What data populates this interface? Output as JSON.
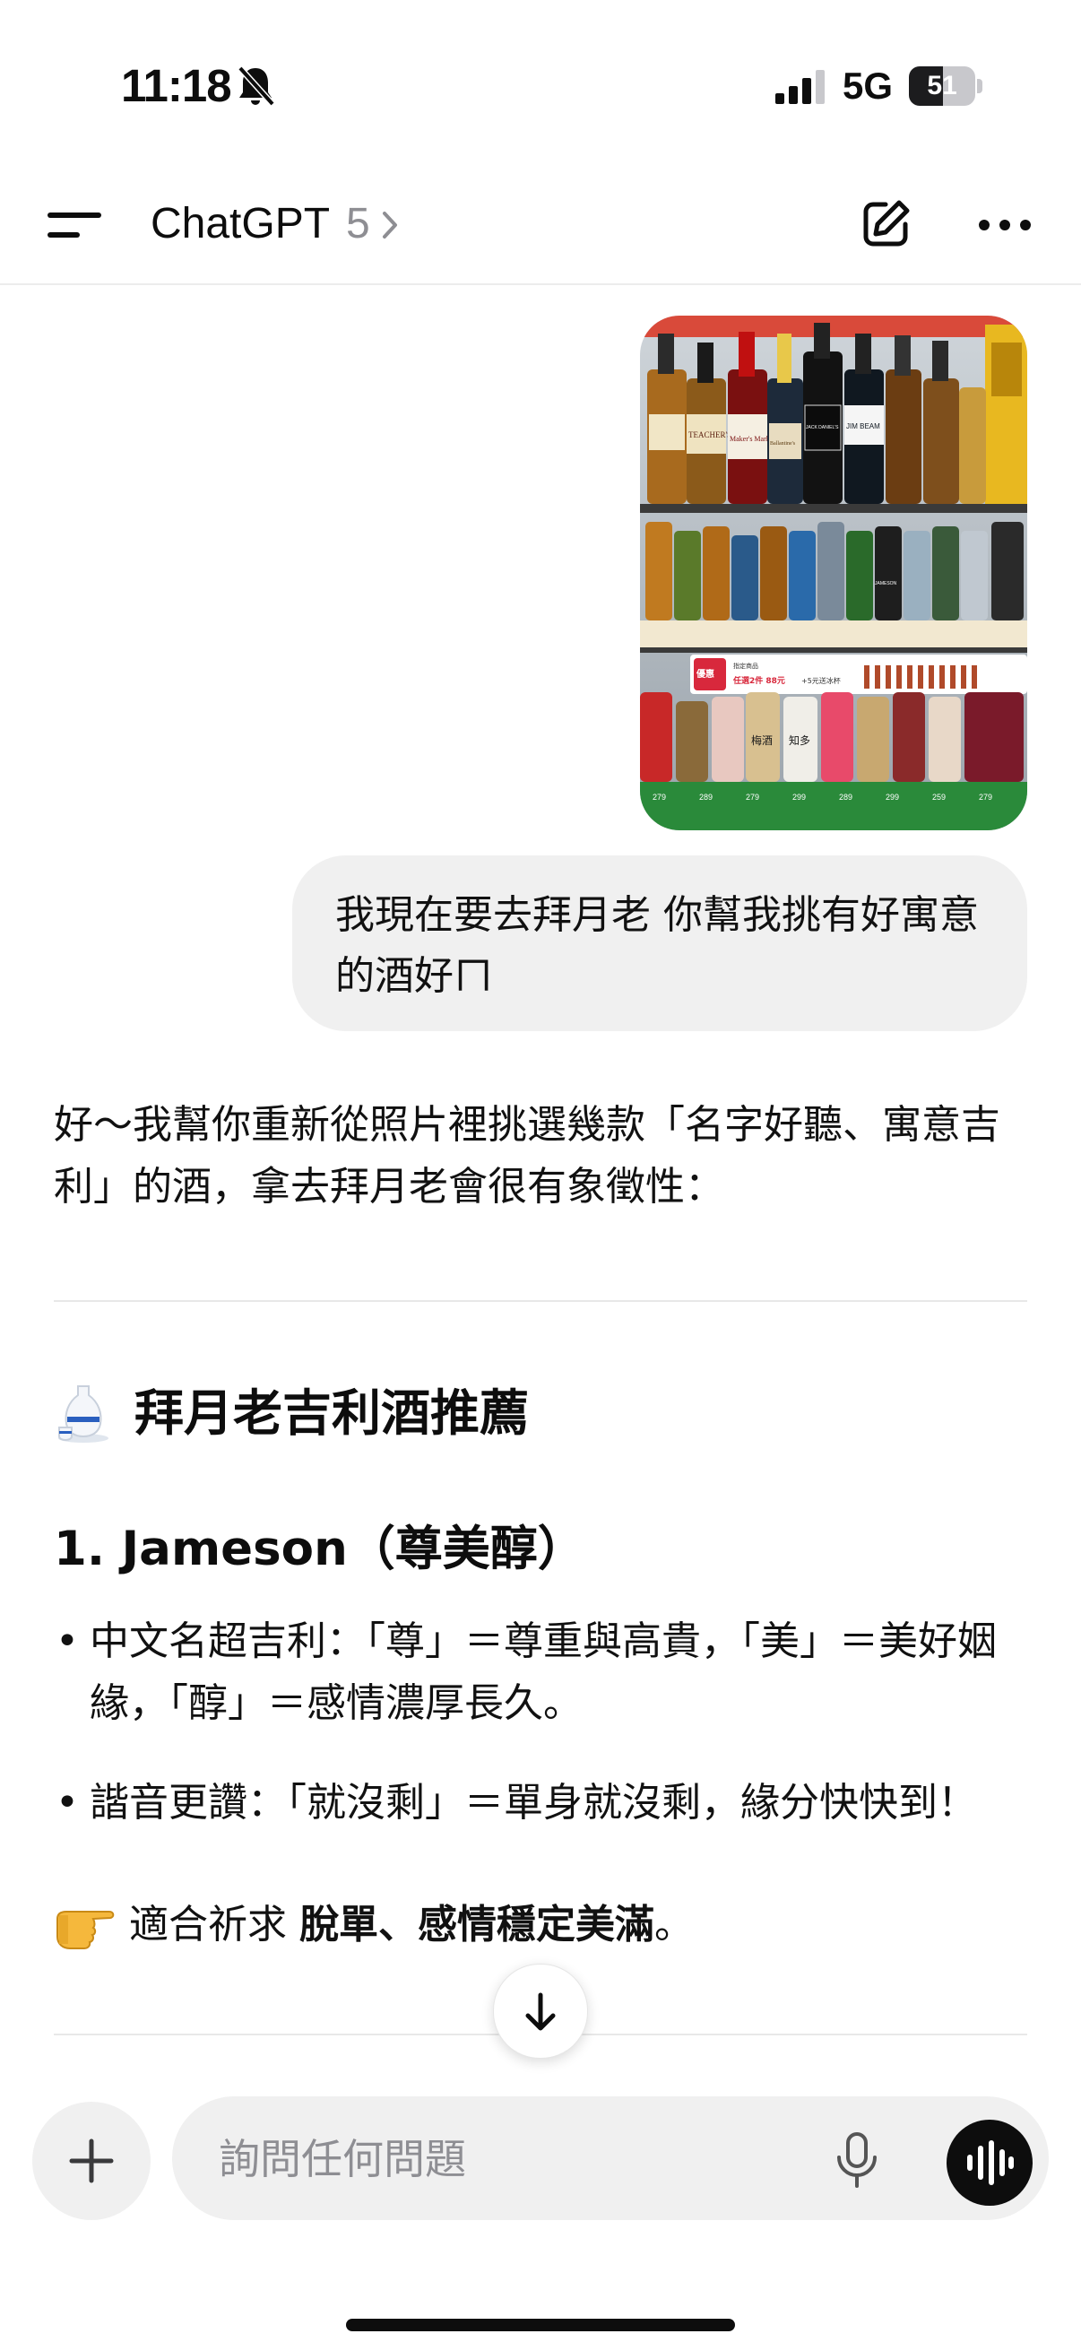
{
  "status_bar": {
    "time": "11:18",
    "network": "5G",
    "battery": "51",
    "battery_level": 0.51
  },
  "header": {
    "title": "ChatGPT",
    "model": "5"
  },
  "conversation": {
    "user_message": "我現在要去拜月老 你幫我挑有好寓意的酒好ㄇ",
    "assistant": {
      "intro": "好～我幫你重新從照片裡挑選幾款「名字好聽、寓意吉利」的酒，拿去拜月老會很有象徵性：",
      "section_title": "拜月老吉利酒推薦",
      "item_title": "1. Jameson（尊美醇）",
      "bullets": [
        "中文名超吉利：「尊」＝尊重與高貴，「美」＝美好姻緣，「醇」＝感情濃厚長久。",
        "諧音更讚：「就沒剩」＝單身就沒剩，緣分快快到！"
      ],
      "suitable_prefix": "適合祈求",
      "suitable_bold": "脫單、感情穩定美滿",
      "suitable_end": "。"
    }
  },
  "photo": {
    "labels": [
      "TEACHER'S",
      "Maker's Mark",
      "JIM BEAM",
      "JACK DANIEL'S",
      "Ballantine's",
      "JAMESON",
      "梅酒",
      "知多",
      "優惠",
      "任選2件 88元",
      "+5元送冰杯",
      "指定商品"
    ],
    "price_tags": [
      "279",
      "289",
      "279",
      "299",
      "289",
      "299",
      "259",
      "279"
    ]
  },
  "composer": {
    "placeholder": "詢問任何問題"
  },
  "icons": {
    "bell": "bell-slash-icon",
    "menu": "menu-icon",
    "edit": "new-chat-icon",
    "more": "more-icon",
    "scroll": "arrow-down-icon",
    "plus": "plus-icon",
    "mic": "mic-icon",
    "voice": "voice-waveform-icon",
    "sake": "sake-icon",
    "hand": "pointing-hand-icon"
  }
}
